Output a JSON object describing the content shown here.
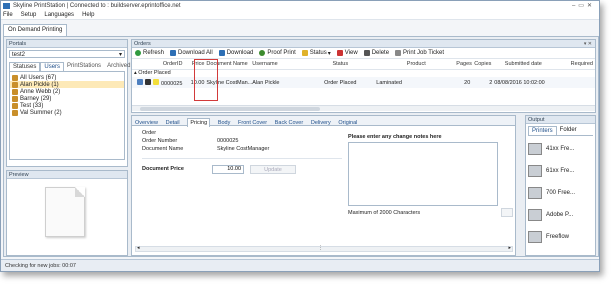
{
  "app": {
    "title": "Skyline PrintStation | Connected to : buildserver.eprintoffice.net"
  },
  "menu": [
    "File",
    "Setup",
    "Languages",
    "Help"
  ],
  "main_tab": "On Demand Printing",
  "portals": {
    "header": "Portals",
    "selected": "test2",
    "tabs": [
      "Statuses",
      "Users",
      "PrintStations",
      "Archived"
    ],
    "users": [
      "All Users (67)",
      "Alan Pickle (1)",
      "Anne Webb (2)",
      "Barney (29)",
      "Test (33)",
      "Val Summer (2)"
    ]
  },
  "preview": {
    "header": "Preview"
  },
  "orders": {
    "header": "Orders",
    "toolbar": [
      "Refresh",
      "Download All",
      "Download",
      "Proof Print",
      "Status",
      "View",
      "Delete",
      "Print Job Ticket"
    ],
    "columns": [
      "OrderID",
      "Price",
      "Document Name",
      "Username",
      "Status",
      "Product",
      "Pages",
      "Copies",
      "Submitted date",
      "Required"
    ],
    "group": "Order Placed",
    "row": {
      "orderid": "0000025",
      "price": "10.00",
      "document": "Skyline CostMan...",
      "username": "Alan Pickle",
      "status": "Order Placed",
      "product": "Laminated",
      "pages": "20",
      "copies": "2",
      "submitted": "08/08/2016 10:02:00"
    }
  },
  "detail": {
    "tabs": [
      "Overview",
      "Detail",
      "Pricing",
      "Body",
      "Front Cover",
      "Back Cover",
      "Delivery",
      "Original"
    ],
    "active_tab": "Pricing",
    "order_label": "Order",
    "order_number_label": "Order Number",
    "order_number": "0000025",
    "document_name_label": "Document Name",
    "document_name": "Skyline CostManager",
    "document_price_label": "Document Price",
    "document_price": "10.00",
    "update_label": "Update",
    "notes_label": "Please enter any change notes here",
    "max_label": "Maximum of 2000 Characters"
  },
  "output": {
    "header": "Output",
    "tabs": [
      "Printers",
      "Folder"
    ],
    "printers": [
      "41xx Fre...",
      "61xx Fre...",
      "700 Free...",
      "Adobe P...",
      "Freeflow"
    ]
  },
  "status": "Checking for new jobs: 00:07",
  "colors": {
    "accent": "#2d6fb5",
    "highlight": "#d23a3a",
    "panel_header": "#dfe7f0"
  }
}
